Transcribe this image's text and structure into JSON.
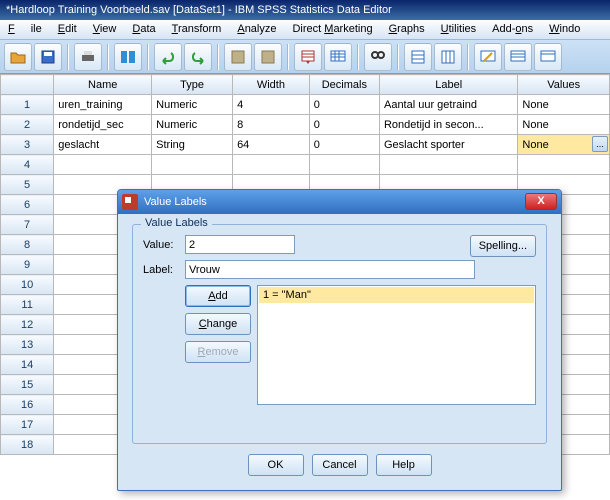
{
  "title": "*Hardloop Training Voorbeeld.sav [DataSet1] - IBM SPSS Statistics Data Editor",
  "menu": {
    "file": "File",
    "edit": "Edit",
    "view": "View",
    "data": "Data",
    "transform": "Transform",
    "analyze": "Analyze",
    "directmarketing": "Direct Marketing",
    "graphs": "Graphs",
    "utilities": "Utilities",
    "addons": "Add-ons",
    "window": "Window"
  },
  "columns": {
    "name": "Name",
    "type": "Type",
    "width": "Width",
    "decimals": "Decimals",
    "label": "Label",
    "values": "Values"
  },
  "rows": [
    {
      "n": "1",
      "name": "uren_training",
      "type": "Numeric",
      "width": "4",
      "decimals": "0",
      "label": "Aantal uur getraind",
      "values": "None"
    },
    {
      "n": "2",
      "name": "rondetijd_sec",
      "type": "Numeric",
      "width": "8",
      "decimals": "0",
      "label": "Rondetijd in secon...",
      "values": "None"
    },
    {
      "n": "3",
      "name": "geslacht",
      "type": "String",
      "width": "64",
      "decimals": "0",
      "label": "Geslacht sporter",
      "values": "None"
    }
  ],
  "emptyRows": [
    "4",
    "5",
    "6",
    "7",
    "8",
    "9",
    "10",
    "11",
    "12",
    "13",
    "14",
    "15",
    "16",
    "17",
    "18"
  ],
  "dialog": {
    "title": "Value Labels",
    "groupTitle": "Value Labels",
    "valueLabel": "Value:",
    "labelLabel": "Label:",
    "valueInput": "2",
    "labelInput": "Vrouw",
    "spelling": "Spelling...",
    "add": "Add",
    "change": "Change",
    "remove": "Remove",
    "listItem0": "1 = \"Man\"",
    "ok": "OK",
    "cancel": "Cancel",
    "help": "Help",
    "closeX": "X",
    "cellBtn": "..."
  }
}
